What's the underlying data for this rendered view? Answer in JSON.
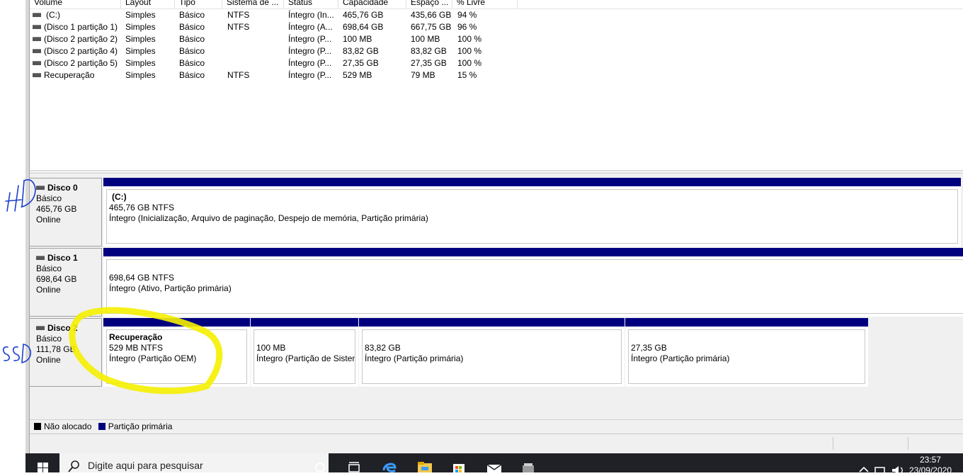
{
  "volume_list": {
    "columns": [
      "Volume",
      "Layout",
      "Tipo",
      "Sistema de ...",
      "Status",
      "Capacidade",
      "Espaço ...",
      "% Livre"
    ],
    "rows": [
      {
        "volume": "(C:)",
        "layout": "Simples",
        "tipo": "Básico",
        "fs": "NTFS",
        "status": "Íntegro (In...",
        "capacidade": "465,76 GB",
        "espaco": "435,66 GB",
        "livre": "94 %"
      },
      {
        "volume": "(Disco 1 partição 1)",
        "layout": "Simples",
        "tipo": "Básico",
        "fs": "NTFS",
        "status": "Íntegro (A...",
        "capacidade": "698,64 GB",
        "espaco": "667,75 GB",
        "livre": "96 %"
      },
      {
        "volume": "(Disco 2 partição 2)",
        "layout": "Simples",
        "tipo": "Básico",
        "fs": "",
        "status": "Íntegro (P...",
        "capacidade": "100 MB",
        "espaco": "100 MB",
        "livre": "100 %"
      },
      {
        "volume": "(Disco 2 partição 4)",
        "layout": "Simples",
        "tipo": "Básico",
        "fs": "",
        "status": "Íntegro (P...",
        "capacidade": "83,82 GB",
        "espaco": "83,82 GB",
        "livre": "100 %"
      },
      {
        "volume": "(Disco 2 partição 5)",
        "layout": "Simples",
        "tipo": "Básico",
        "fs": "",
        "status": "Íntegro (P...",
        "capacidade": "27,35 GB",
        "espaco": "27,35 GB",
        "livre": "100 %"
      },
      {
        "volume": "Recuperação",
        "layout": "Simples",
        "tipo": "Básico",
        "fs": "NTFS",
        "status": "Íntegro (P...",
        "capacidade": "529 MB",
        "espaco": "79 MB",
        "livre": "15 %"
      }
    ]
  },
  "disks": [
    {
      "name": "Disco 0",
      "type": "Básico",
      "size": "465,76 GB",
      "state": "Online",
      "partitions": [
        {
          "title": "(C:)",
          "size": "465,76 GB NTFS",
          "status": "Íntegro (Inicialização, Arquivo de paginação, Despejo de memória, Partição primária)"
        }
      ]
    },
    {
      "name": "Disco 1",
      "type": "Básico",
      "size": "698,64 GB",
      "state": "Online",
      "partitions": [
        {
          "title": "",
          "size": "698,64 GB NTFS",
          "status": "Íntegro (Ativo, Partição primária)"
        }
      ]
    },
    {
      "name": "Disco 2",
      "type": "Básico",
      "size": "111,78 GB",
      "state": "Online",
      "partitions": [
        {
          "title": "Recuperação",
          "size": "529 MB NTFS",
          "status": "Íntegro (Partição OEM)"
        },
        {
          "title": "",
          "size": "100 MB",
          "status": "Íntegro (Partição de Sisten"
        },
        {
          "title": "",
          "size": "83,82 GB",
          "status": "Íntegro (Partição primária)"
        },
        {
          "title": "",
          "size": "27,35 GB",
          "status": "Íntegro (Partição primária)"
        }
      ]
    }
  ],
  "annotations": {
    "hd": "HD",
    "ssd": "SSD"
  },
  "legend": {
    "unallocated": "Não alocado",
    "primary": "Partição primária"
  },
  "colors": {
    "partition_bar": "#00007f",
    "unallocated": "#000000",
    "highlight": "#f5f000",
    "pen": "#1a3fd0"
  },
  "taskbar": {
    "search_placeholder": "Digite aqui para pesquisar",
    "time": "23:57",
    "date": "23/09/2020",
    "icons": [
      "windows-start-icon",
      "search-icon",
      "cortana-icon",
      "task-view-icon",
      "edge-icon",
      "file-explorer-icon",
      "store-icon",
      "mail-icon",
      "app-icon",
      "chevron-up-icon",
      "network-icon",
      "volume-icon"
    ]
  }
}
